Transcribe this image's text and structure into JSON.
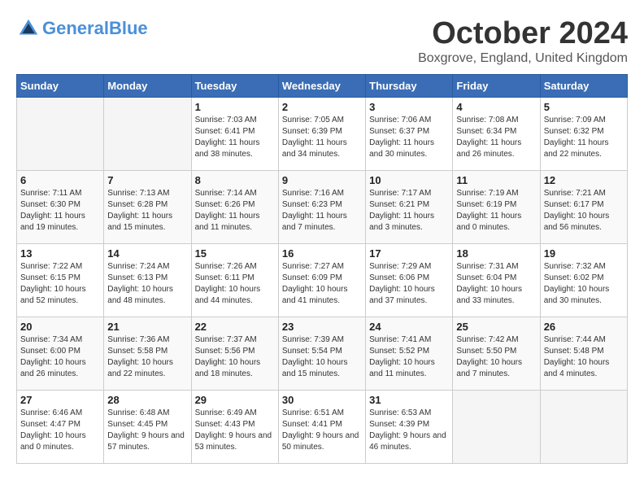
{
  "header": {
    "logo_line1": "General",
    "logo_line2": "Blue",
    "month": "October 2024",
    "location": "Boxgrove, England, United Kingdom"
  },
  "weekdays": [
    "Sunday",
    "Monday",
    "Tuesday",
    "Wednesday",
    "Thursday",
    "Friday",
    "Saturday"
  ],
  "weeks": [
    [
      {
        "day": "",
        "info": ""
      },
      {
        "day": "",
        "info": ""
      },
      {
        "day": "1",
        "info": "Sunrise: 7:03 AM\nSunset: 6:41 PM\nDaylight: 11 hours and 38 minutes."
      },
      {
        "day": "2",
        "info": "Sunrise: 7:05 AM\nSunset: 6:39 PM\nDaylight: 11 hours and 34 minutes."
      },
      {
        "day": "3",
        "info": "Sunrise: 7:06 AM\nSunset: 6:37 PM\nDaylight: 11 hours and 30 minutes."
      },
      {
        "day": "4",
        "info": "Sunrise: 7:08 AM\nSunset: 6:34 PM\nDaylight: 11 hours and 26 minutes."
      },
      {
        "day": "5",
        "info": "Sunrise: 7:09 AM\nSunset: 6:32 PM\nDaylight: 11 hours and 22 minutes."
      }
    ],
    [
      {
        "day": "6",
        "info": "Sunrise: 7:11 AM\nSunset: 6:30 PM\nDaylight: 11 hours and 19 minutes."
      },
      {
        "day": "7",
        "info": "Sunrise: 7:13 AM\nSunset: 6:28 PM\nDaylight: 11 hours and 15 minutes."
      },
      {
        "day": "8",
        "info": "Sunrise: 7:14 AM\nSunset: 6:26 PM\nDaylight: 11 hours and 11 minutes."
      },
      {
        "day": "9",
        "info": "Sunrise: 7:16 AM\nSunset: 6:23 PM\nDaylight: 11 hours and 7 minutes."
      },
      {
        "day": "10",
        "info": "Sunrise: 7:17 AM\nSunset: 6:21 PM\nDaylight: 11 hours and 3 minutes."
      },
      {
        "day": "11",
        "info": "Sunrise: 7:19 AM\nSunset: 6:19 PM\nDaylight: 11 hours and 0 minutes."
      },
      {
        "day": "12",
        "info": "Sunrise: 7:21 AM\nSunset: 6:17 PM\nDaylight: 10 hours and 56 minutes."
      }
    ],
    [
      {
        "day": "13",
        "info": "Sunrise: 7:22 AM\nSunset: 6:15 PM\nDaylight: 10 hours and 52 minutes."
      },
      {
        "day": "14",
        "info": "Sunrise: 7:24 AM\nSunset: 6:13 PM\nDaylight: 10 hours and 48 minutes."
      },
      {
        "day": "15",
        "info": "Sunrise: 7:26 AM\nSunset: 6:11 PM\nDaylight: 10 hours and 44 minutes."
      },
      {
        "day": "16",
        "info": "Sunrise: 7:27 AM\nSunset: 6:09 PM\nDaylight: 10 hours and 41 minutes."
      },
      {
        "day": "17",
        "info": "Sunrise: 7:29 AM\nSunset: 6:06 PM\nDaylight: 10 hours and 37 minutes."
      },
      {
        "day": "18",
        "info": "Sunrise: 7:31 AM\nSunset: 6:04 PM\nDaylight: 10 hours and 33 minutes."
      },
      {
        "day": "19",
        "info": "Sunrise: 7:32 AM\nSunset: 6:02 PM\nDaylight: 10 hours and 30 minutes."
      }
    ],
    [
      {
        "day": "20",
        "info": "Sunrise: 7:34 AM\nSunset: 6:00 PM\nDaylight: 10 hours and 26 minutes."
      },
      {
        "day": "21",
        "info": "Sunrise: 7:36 AM\nSunset: 5:58 PM\nDaylight: 10 hours and 22 minutes."
      },
      {
        "day": "22",
        "info": "Sunrise: 7:37 AM\nSunset: 5:56 PM\nDaylight: 10 hours and 18 minutes."
      },
      {
        "day": "23",
        "info": "Sunrise: 7:39 AM\nSunset: 5:54 PM\nDaylight: 10 hours and 15 minutes."
      },
      {
        "day": "24",
        "info": "Sunrise: 7:41 AM\nSunset: 5:52 PM\nDaylight: 10 hours and 11 minutes."
      },
      {
        "day": "25",
        "info": "Sunrise: 7:42 AM\nSunset: 5:50 PM\nDaylight: 10 hours and 7 minutes."
      },
      {
        "day": "26",
        "info": "Sunrise: 7:44 AM\nSunset: 5:48 PM\nDaylight: 10 hours and 4 minutes."
      }
    ],
    [
      {
        "day": "27",
        "info": "Sunrise: 6:46 AM\nSunset: 4:47 PM\nDaylight: 10 hours and 0 minutes."
      },
      {
        "day": "28",
        "info": "Sunrise: 6:48 AM\nSunset: 4:45 PM\nDaylight: 9 hours and 57 minutes."
      },
      {
        "day": "29",
        "info": "Sunrise: 6:49 AM\nSunset: 4:43 PM\nDaylight: 9 hours and 53 minutes."
      },
      {
        "day": "30",
        "info": "Sunrise: 6:51 AM\nSunset: 4:41 PM\nDaylight: 9 hours and 50 minutes."
      },
      {
        "day": "31",
        "info": "Sunrise: 6:53 AM\nSunset: 4:39 PM\nDaylight: 9 hours and 46 minutes."
      },
      {
        "day": "",
        "info": ""
      },
      {
        "day": "",
        "info": ""
      }
    ]
  ]
}
